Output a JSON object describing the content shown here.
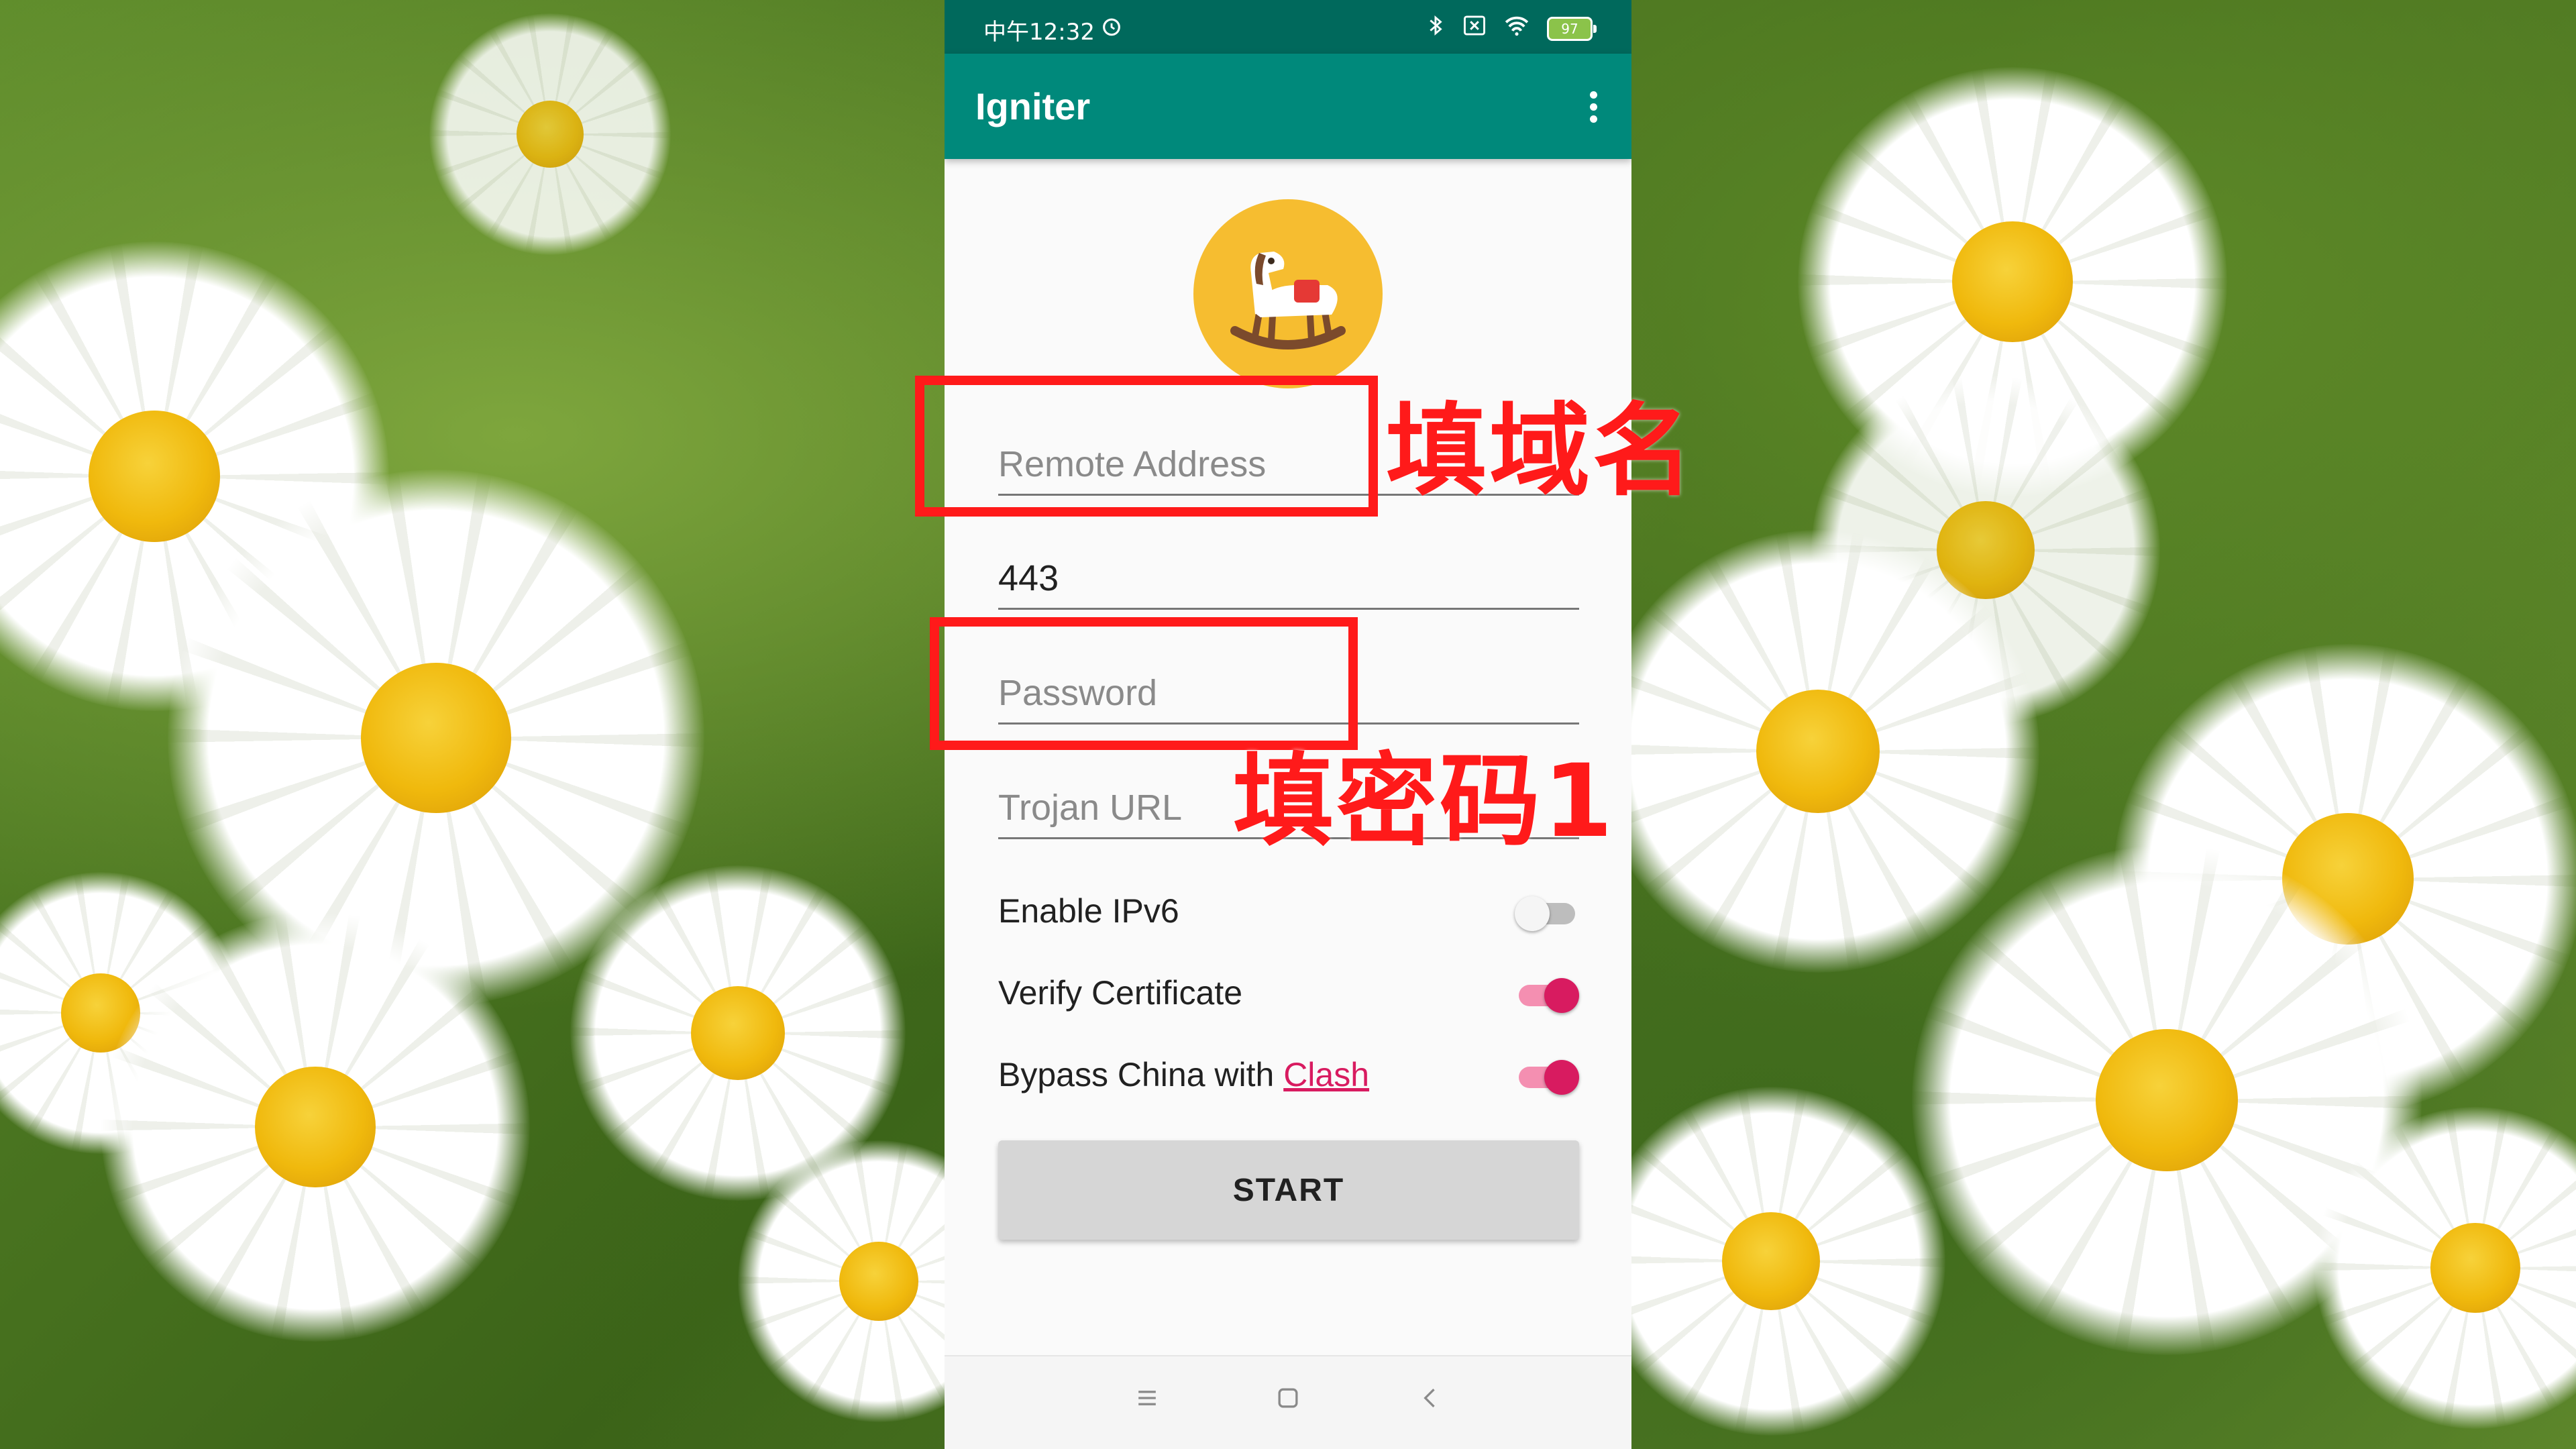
{
  "status_bar": {
    "time": "中午12:32",
    "battery": "97"
  },
  "app": {
    "title": "Igniter"
  },
  "form": {
    "remote_address_placeholder": "Remote Address",
    "port_value": "443",
    "password_placeholder": "Password",
    "trojan_url_placeholder": "Trojan URL"
  },
  "toggles": [
    {
      "label": "Enable IPv6",
      "on": false
    },
    {
      "label": "Verify Certificate",
      "on": true
    },
    {
      "label_prefix": "Bypass China with ",
      "link": "Clash",
      "on": true
    }
  ],
  "start_button": {
    "label": "START"
  },
  "annotations": {
    "domain_note": "填域名",
    "password_note": "填密码1"
  },
  "colors": {
    "status_bar": "#00695c",
    "app_bar": "#00897b",
    "accent": "#d81b60",
    "annotation": "#ff1a1a",
    "logo_bg": "#f6bd30"
  },
  "icons": {
    "alarm": "alarm-icon",
    "bluetooth": "bluetooth-icon",
    "wifi": "wifi-icon",
    "overflow": "more-vert-icon",
    "logo": "rocking-horse-icon"
  }
}
